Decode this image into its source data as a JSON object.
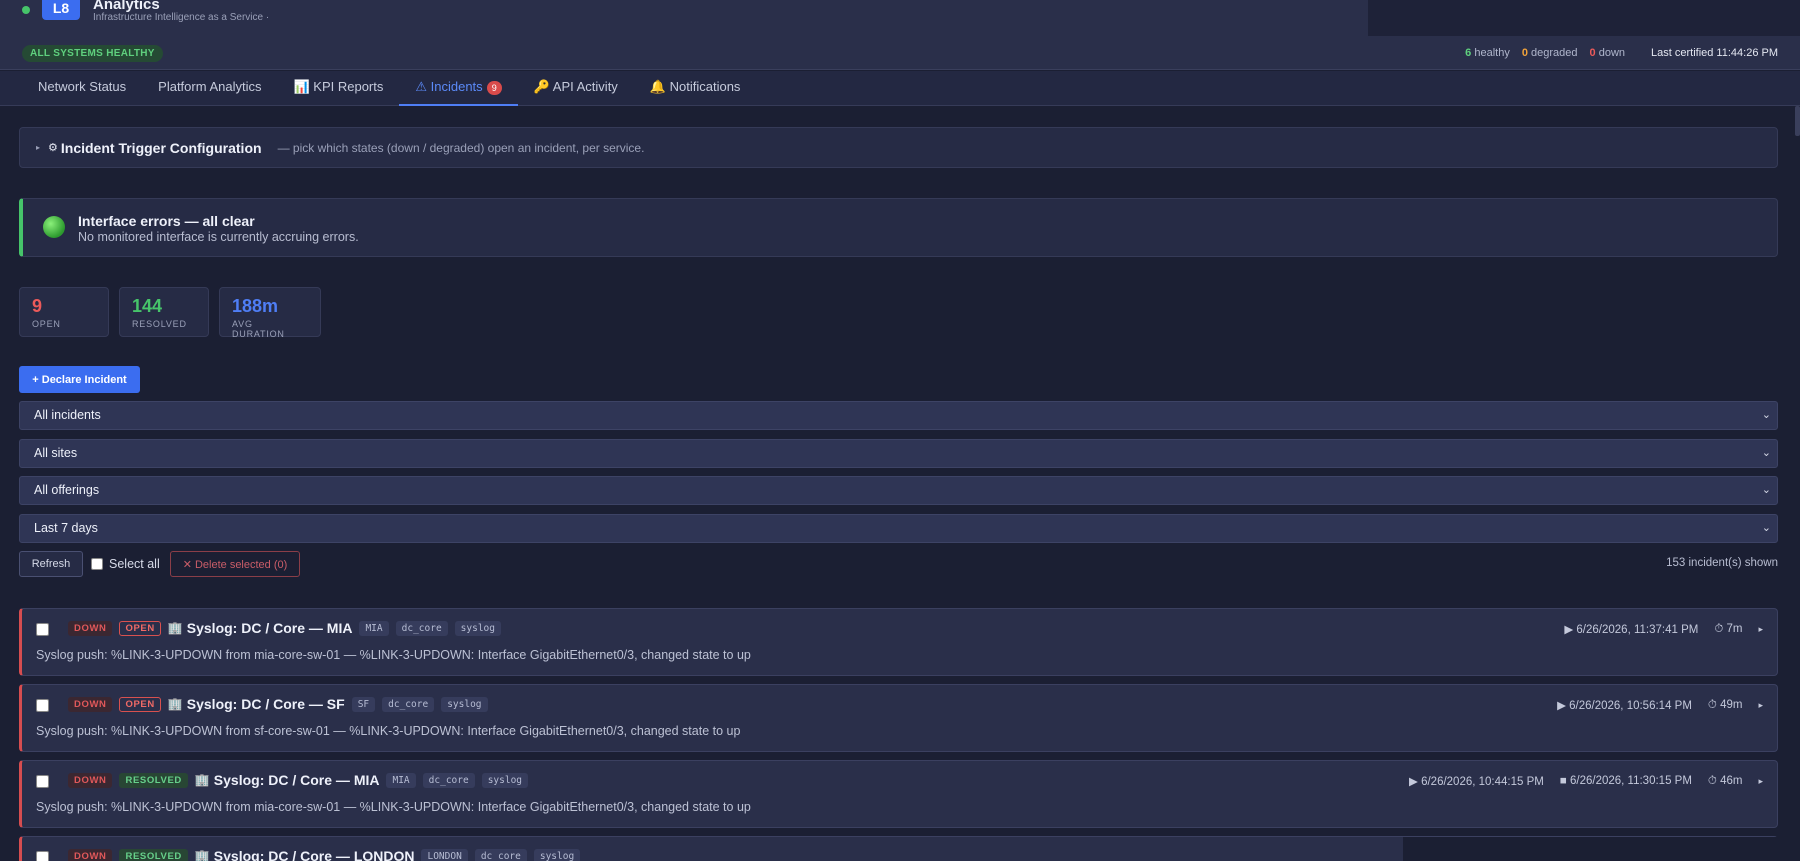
{
  "app": {
    "logo_text": "L8",
    "title": "Analytics",
    "subtitle": "Infrastructure Intelligence as a Service ·"
  },
  "status": {
    "healthy_pill": "ALL SYSTEMS HEALTHY",
    "healthy_count": "6",
    "healthy_label": "healthy",
    "degraded_count": "0",
    "degraded_label": "degraded",
    "down_count": "0",
    "down_label": "down",
    "last_certified": "Last certified 11:44:26 PM"
  },
  "tabs": [
    {
      "label": "Network Status"
    },
    {
      "label": "Platform Analytics"
    },
    {
      "label": "📊 KPI Reports"
    },
    {
      "label": "⚠ Incidents",
      "badge": "9"
    },
    {
      "label": "🔑 API Activity"
    },
    {
      "label": "🔔 Notifications"
    }
  ],
  "config": {
    "caret": "▸",
    "icon": "⚙",
    "title": "Incident Trigger Configuration",
    "hint": "— pick which states (down / degraded) open an incident, per service."
  },
  "interface_errors": {
    "title": "Interface errors — all clear",
    "text": "No monitored interface is currently accruing errors."
  },
  "stats": [
    {
      "value": "9",
      "label": "OPEN",
      "color": "#ec5a5a"
    },
    {
      "value": "144",
      "label": "RESOLVED",
      "color": "#46c46a"
    },
    {
      "value": "188m",
      "label": "AVG DURATION",
      "color": "#4f7ef5"
    }
  ],
  "declare_label": "+ Declare Incident",
  "filters": {
    "incidents": "All incidents",
    "sites": "All sites",
    "offerings": "All offerings",
    "range": "Last 7 days"
  },
  "actions": {
    "refresh": "Refresh",
    "select_all": "Select all",
    "delete_selected": "✕ Delete selected (0)",
    "shown": "153 incident(s) shown"
  },
  "incidents": [
    {
      "state": "DOWN",
      "status": "OPEN",
      "name": "Syslog: DC / Core — MIA",
      "tags": [
        "MIA",
        "dc_core",
        "syslog"
      ],
      "body": "Syslog push: %LINK-3-UPDOWN from mia-core-sw-01 — %LINK-3-UPDOWN: Interface GigabitEthernet0/3, changed state to up",
      "started": "▶ 6/26/2026, 11:37:41 PM",
      "ended": "",
      "duration": "⏱ 7m"
    },
    {
      "state": "DOWN",
      "status": "OPEN",
      "name": "Syslog: DC / Core — SF",
      "tags": [
        "SF",
        "dc_core",
        "syslog"
      ],
      "body": "Syslog push: %LINK-3-UPDOWN from sf-core-sw-01 — %LINK-3-UPDOWN: Interface GigabitEthernet0/3, changed state to up",
      "started": "▶ 6/26/2026, 10:56:14 PM",
      "ended": "",
      "duration": "⏱ 49m"
    },
    {
      "state": "DOWN",
      "status": "RESOLVED",
      "name": "Syslog: DC / Core — MIA",
      "tags": [
        "MIA",
        "dc_core",
        "syslog"
      ],
      "body": "Syslog push: %LINK-3-UPDOWN from mia-core-sw-01 — %LINK-3-UPDOWN: Interface GigabitEthernet0/3, changed state to up",
      "started": "▶ 6/26/2026, 10:44:15 PM",
      "ended": "■ 6/26/2026, 11:30:15 PM",
      "duration": "⏱ 46m"
    },
    {
      "state": "DOWN",
      "status": "RESOLVED",
      "name": "Syslog: DC / Core — LONDON",
      "tags": [
        "LONDON",
        "dc_core",
        "syslog"
      ],
      "body": "",
      "started": "",
      "ended": "",
      "duration": ""
    }
  ]
}
